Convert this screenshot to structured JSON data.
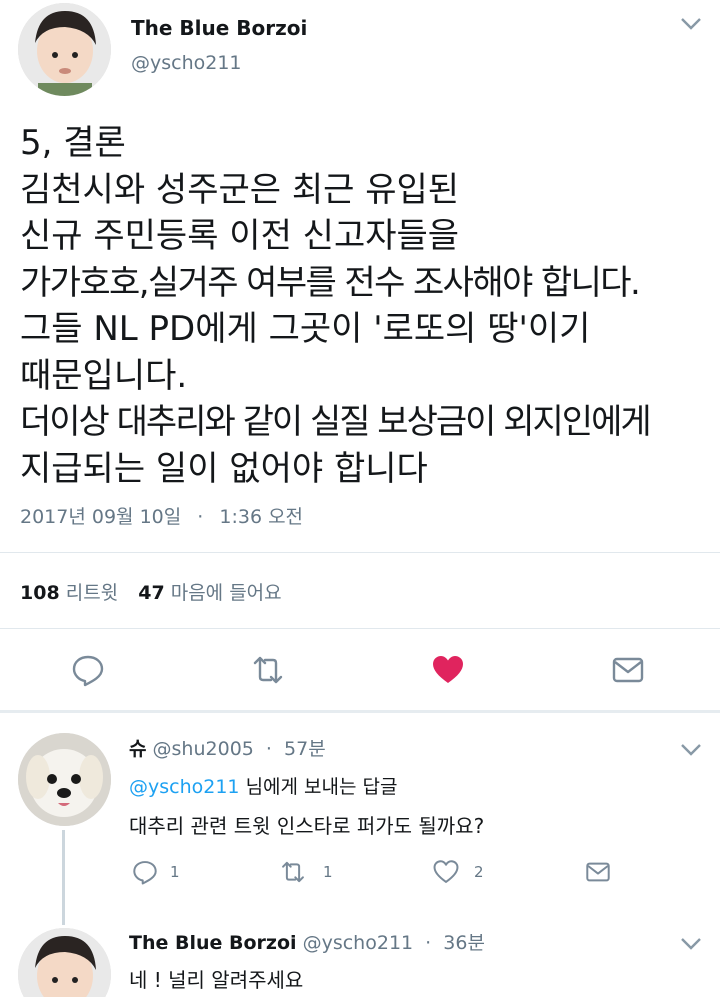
{
  "main_tweet": {
    "author_name": "The Blue Borzoi",
    "author_handle": "@yscho211",
    "text_lines": [
      "5, 결론",
      "김천시와 성주군은 최근 유입된",
      "신규 주민등록 이전 신고자들을",
      "가가호호,실거주 여부를 전수 조사해야 합니다.",
      "그들 NL PD에게 그곳이 '로또의 땅'이기",
      "때문입니다.",
      "더이상 대추리와 같이 실질 보상금이 외지인에게",
      "지급되는 일이 없어야 합니다"
    ],
    "date": "2017년 09월 10일",
    "separator": "·",
    "time": "1:36 오전",
    "retweet_count": "108",
    "retweet_label": "리트윗",
    "like_count": "47",
    "like_label": "마음에 들어요",
    "liked": true,
    "icons": [
      "reply-icon",
      "retweet-icon",
      "heart-icon",
      "message-icon"
    ]
  },
  "reply": {
    "author_name": "슈",
    "author_handle": "@shu2005",
    "separator": "·",
    "time": "57분",
    "replying_handle": "@yscho211",
    "replying_suffix": " 님에게 보내는 답글",
    "text": "대추리 관련 트윗 인스타로 퍼가도 될까요?",
    "reply_count": "1",
    "retweet_count": "1",
    "like_count": "2"
  },
  "reply2": {
    "author_name": "The Blue Borzoi",
    "author_handle": "@yscho211",
    "separator": "·",
    "time": "36분",
    "text": "네 ! 널리 알려주세요"
  },
  "colors": {
    "like_active": "#e0245e",
    "link": "#1da1f2",
    "secondary": "#657786",
    "icon": "#7a8a99"
  }
}
